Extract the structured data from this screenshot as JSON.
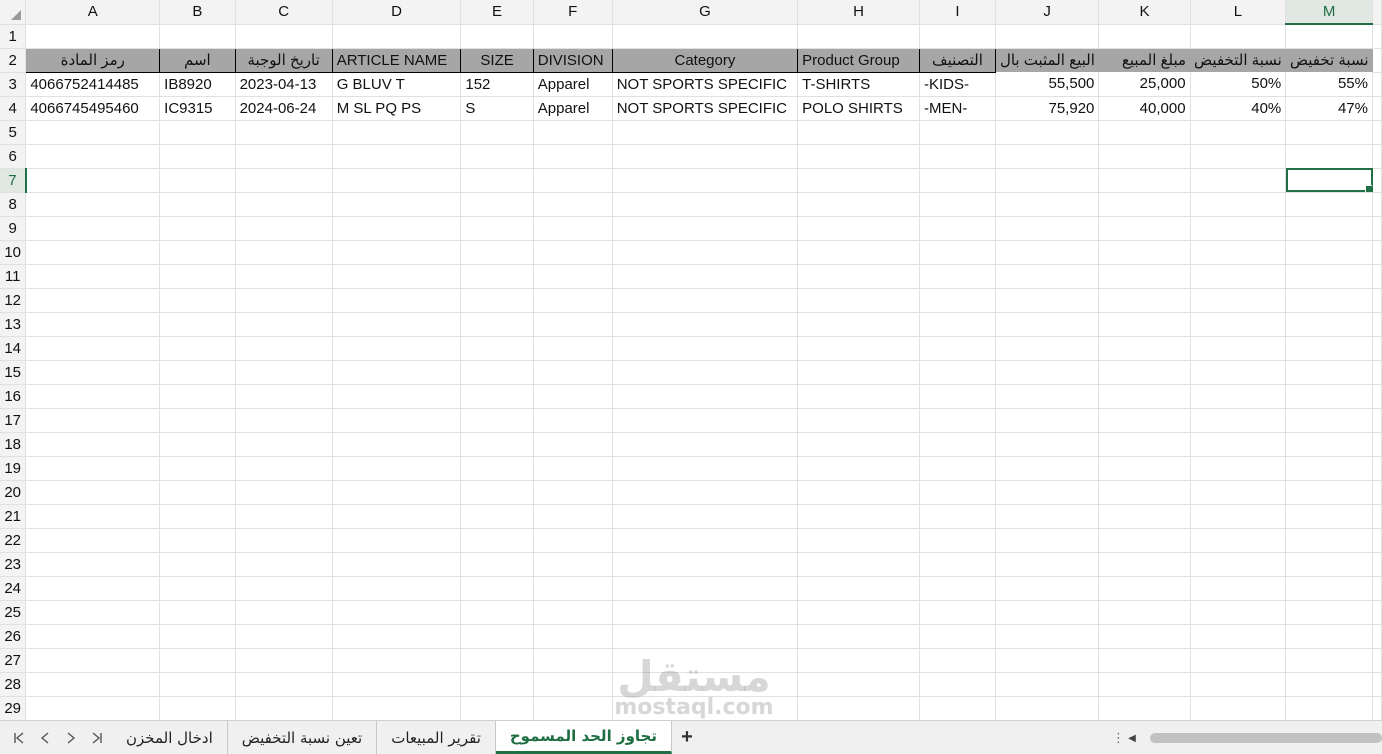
{
  "columns": [
    "A",
    "B",
    "C",
    "D",
    "E",
    "F",
    "G",
    "H",
    "I",
    "J",
    "K",
    "L",
    "M"
  ],
  "selected_column": "M",
  "rows": [
    "1",
    "2",
    "3",
    "4",
    "5",
    "6",
    "7",
    "8",
    "9",
    "10",
    "11",
    "12",
    "13",
    "14",
    "15",
    "16",
    "17",
    "18",
    "19",
    "20",
    "21",
    "22",
    "23",
    "24",
    "25",
    "26",
    "27",
    "28",
    "29"
  ],
  "selected_row": "7",
  "header_row": [
    "رمز المادة",
    "اسم",
    "تاريخ الوجبة",
    "ARTICLE NAME",
    "SIZE",
    "DIVISION",
    "Category",
    "Product Group",
    "التصنيف",
    "البيع المثبت بال",
    "مبلغ المبيع",
    "نسبة التخفيض",
    "نسبة تخفيض"
  ],
  "data_rows": [
    [
      "4066752414485",
      "IB8920",
      "2023-04-13",
      "G BLUV T",
      "152",
      "Apparel",
      "NOT SPORTS SPECIFIC",
      "T-SHIRTS",
      "-KIDS-",
      "55,500",
      "25,000",
      "50%",
      "55%"
    ],
    [
      "4066745495460",
      "IC9315",
      "2024-06-24",
      "M SL PQ PS",
      "S",
      "Apparel",
      "NOT SPORTS SPECIFIC",
      "POLO SHIRTS",
      "-MEN-",
      "75,920",
      "40,000",
      "40%",
      "47%"
    ]
  ],
  "sheet_tabs": [
    "ادخال المخزن",
    "تعين نسبة التخفيض",
    "تقرير المبيعات",
    "تجاوز الحد المسموح"
  ],
  "active_tab_index": 3,
  "watermark": {
    "arabic": "مستقل",
    "latin": "mostaql.com"
  },
  "icons": {
    "corner": "select-all-triangle-icon",
    "first": "first-sheet-icon",
    "prev": "prev-sheet-icon",
    "next": "next-sheet-icon",
    "last": "last-sheet-icon",
    "add": "add-sheet-icon"
  },
  "colors": {
    "accent": "#1f7145",
    "header_fill": "#a6a6a6"
  }
}
